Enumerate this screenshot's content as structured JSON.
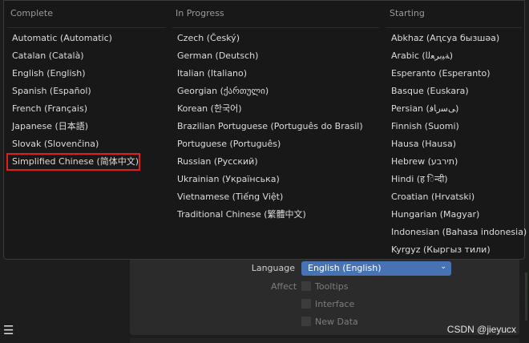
{
  "columns": [
    {
      "header": "Complete",
      "items": [
        "Automatic (Automatic)",
        "Catalan (Català)",
        "English (English)",
        "Spanish (Español)",
        "French (Français)",
        "Japanese (日本語)",
        "Slovak (Slovenčina)",
        "Simplified Chinese (简体中文)"
      ]
    },
    {
      "header": "In Progress",
      "items": [
        "Czech (Český)",
        "German (Deutsch)",
        "Italian (Italiano)",
        "Georgian (ქართული)",
        "Korean (한국어)",
        "Brazilian Portuguese (Português do Brasil)",
        "Portuguese (Português)",
        "Russian (Русский)",
        "Ukrainian (Українська)",
        "Vietnamese (Tiếng Việt)",
        "Traditional Chinese (繁體中文)"
      ]
    },
    {
      "header": "Starting",
      "items": [
        "Abkhaz (Аԥсуа бызшәа)",
        "Arabic (ﺔﻴﺑﺮﻌﻟﺍ)",
        "Esperanto (Esperanto)",
        "Basque (Euskara)",
        "Persian (ﯽﺳﺭﺎﻓ)",
        "Finnish (Suomi)",
        "Hausa (Hausa)",
        "Hebrew (תירבע)",
        "Hindi (ह िन्दी)",
        "Croatian (Hrvatski)",
        "Hungarian (Magyar)",
        "Indonesian (Bahasa indonesia)",
        "Kyrgyz (Кыргыз тили)"
      ]
    }
  ],
  "language_field": {
    "label": "Language",
    "value": "English (English)"
  },
  "affect": {
    "label": "Affect",
    "options": [
      {
        "label": "Tooltips"
      },
      {
        "label": "Interface"
      },
      {
        "label": "New Data"
      }
    ]
  },
  "watermark": "CSDN @jieyucx",
  "colors": {
    "accent": "#4772b3",
    "highlight_box": "#e02020",
    "popup_bg": "#181818"
  }
}
